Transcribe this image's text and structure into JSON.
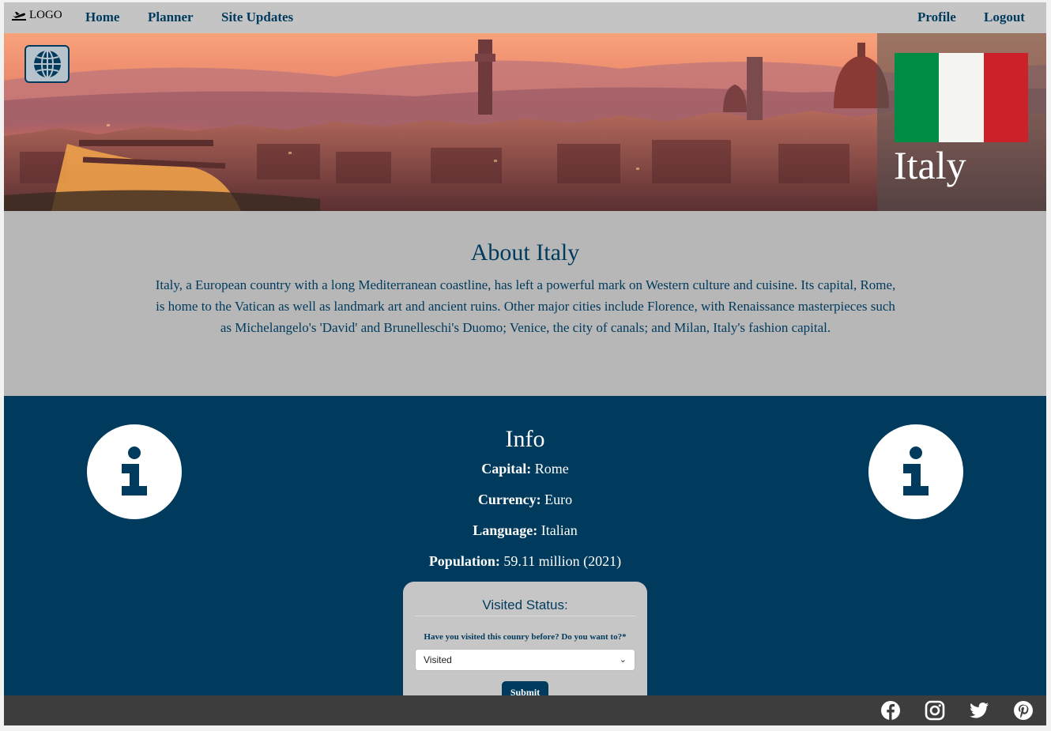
{
  "nav": {
    "logo_label": "LOGO",
    "links": [
      "Home",
      "Planner",
      "Site Updates"
    ],
    "right_links": [
      "Profile",
      "Logout"
    ]
  },
  "hero": {
    "country_name": "Italy",
    "flag_colors": [
      "#008c45",
      "#f4f5f0",
      "#cd212a"
    ]
  },
  "about": {
    "heading": "About Italy",
    "text": "Italy, a European country with a long Mediterranean coastline, has left a powerful mark on Western culture and cuisine. Its capital, Rome, is home to the Vatican as well as landmark art and ancient ruins. Other major cities include Florence, with Renaissance masterpieces such as Michelangelo's 'David' and Brunelleschi's Duomo; Venice, the city of canals; and Milan, Italy's fashion capital."
  },
  "info": {
    "heading": "Info",
    "facts": [
      {
        "label": "Capital:",
        "value": "Rome"
      },
      {
        "label": "Currency:",
        "value": "Euro"
      },
      {
        "label": "Language:",
        "value": "Italian"
      },
      {
        "label": "Population:",
        "value": "59.11 million (2021)"
      }
    ]
  },
  "visited": {
    "title": "Visited Status:",
    "question": "Have you visited this counry before? Do you want to?*",
    "selected": "Visited",
    "submit_label": "Submit"
  },
  "footer": {
    "icons": [
      "facebook-icon",
      "instagram-icon",
      "twitter-icon",
      "pinterest-icon"
    ]
  },
  "colors": {
    "primary": "#003a5d",
    "nav_bg": "#c4c4c4",
    "about_bg": "#b7b7b7",
    "footer_bg": "#3d3d3d"
  }
}
